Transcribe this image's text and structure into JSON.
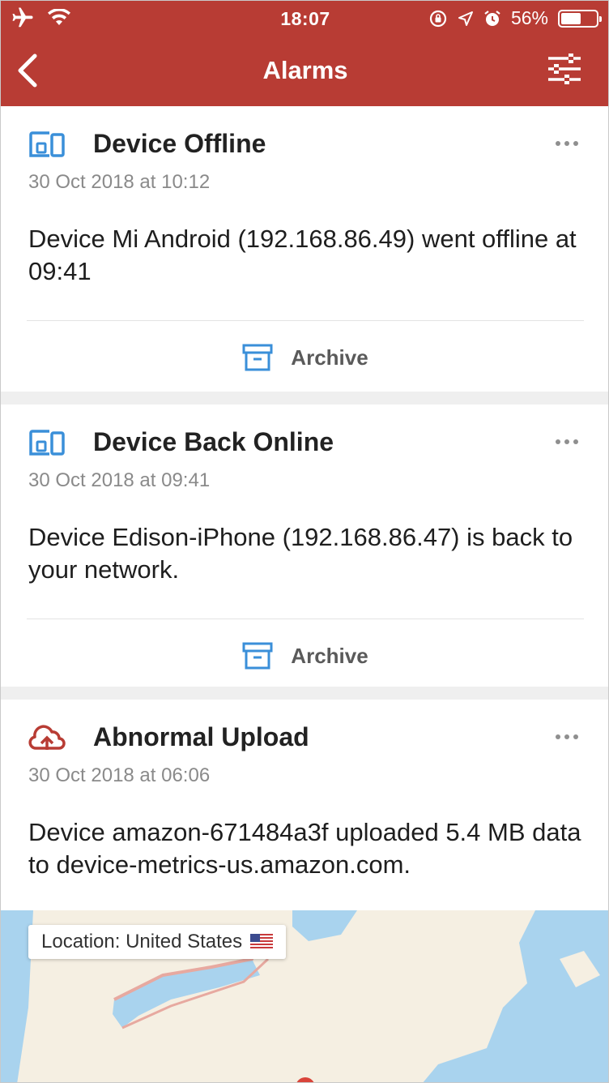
{
  "status_bar": {
    "time": "18:07",
    "battery": "56%",
    "battery_level": 0.56
  },
  "nav": {
    "title": "Alarms",
    "back_icon": "chevron-left-icon",
    "filter_icon": "sliders-icon"
  },
  "alarms": [
    {
      "icon": "devices-icon",
      "title": "Device Offline",
      "time": "30 Oct 2018 at 10:12",
      "description": "Device Mi Android (192.168.86.49) went offline at 09:41",
      "archive_label": "Archive"
    },
    {
      "icon": "devices-icon",
      "title": "Device Back Online",
      "time": "30 Oct 2018 at 09:41",
      "description": "Device Edison-iPhone (192.168.86.47) is back to your network.",
      "archive_label": "Archive"
    },
    {
      "icon": "cloud-upload-icon",
      "title": "Abnormal Upload",
      "time": "30 Oct 2018 at 06:06",
      "description": "Device amazon-671484a3f uploaded 5.4 MB data to device-metrics-us.amazon.com."
    }
  ],
  "map": {
    "location_label": "Location: United States",
    "flag_icon": "us-flag-icon"
  },
  "colors": {
    "header": "#b83c34",
    "device_icon": "#3a8fd9",
    "upload_icon": "#b83c34",
    "archive_icon": "#3a8fd9",
    "water": "#a9d3ee",
    "land": "#f5efe2"
  }
}
